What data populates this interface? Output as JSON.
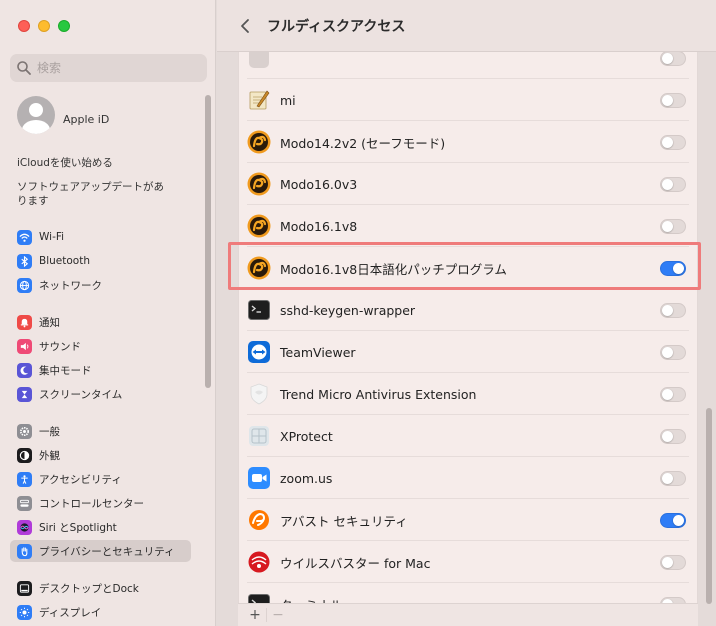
{
  "search": {
    "placeholder": "検索"
  },
  "apple_id": {
    "label": "Apple iD"
  },
  "sidebar_links": [
    {
      "label": "iCloudを使い始める"
    },
    {
      "label": "ソフトウェアアップデートがあります"
    }
  ],
  "sidebar": {
    "items": [
      {
        "label": "Wi-Fi",
        "icon": "wifi-icon",
        "color": "#2f7df6"
      },
      {
        "label": "Bluetooth",
        "icon": "bluetooth-icon",
        "color": "#2f7df6"
      },
      {
        "label": "ネットワーク",
        "icon": "globe-icon",
        "color": "#2f7df6"
      },
      {
        "label": "通知",
        "icon": "bell-icon",
        "color": "#ef4a47"
      },
      {
        "label": "サウンド",
        "icon": "speaker-icon",
        "color": "#ef4a76"
      },
      {
        "label": "集中モード",
        "icon": "moon-icon",
        "color": "#5a55d6"
      },
      {
        "label": "スクリーンタイム",
        "icon": "hourglass-icon",
        "color": "#5a55d6"
      },
      {
        "label": "一般",
        "icon": "gear-icon",
        "color": "#8e8e93"
      },
      {
        "label": "外観",
        "icon": "appearance-icon",
        "color": "#1c1c1e"
      },
      {
        "label": "アクセシビリティ",
        "icon": "accessibility-icon",
        "color": "#2f7df6"
      },
      {
        "label": "コントロールセンター",
        "icon": "control-center-icon",
        "color": "#8e8e93"
      },
      {
        "label": "Siri とSpotlight",
        "icon": "siri-icon",
        "color": "#b03bd9"
      },
      {
        "label": "プライバシーとセキュリティ",
        "icon": "hand-icon",
        "color": "#2f7df6",
        "selected": true
      },
      {
        "label": "デスクトップとDock",
        "icon": "dock-icon",
        "color": "#1c1c1e"
      },
      {
        "label": "ディスプレイ",
        "icon": "sun-icon",
        "color": "#2f7df6"
      }
    ]
  },
  "header": {
    "title": "フルディスクアクセス"
  },
  "apps": [
    {
      "name": "",
      "icon": "unknown-icon",
      "enabled": false
    },
    {
      "name": "mi",
      "icon": "mi-icon",
      "enabled": false
    },
    {
      "name": "Modo14.2v2 (セーフモード)",
      "icon": "modo-icon",
      "enabled": false
    },
    {
      "name": "Modo16.0v3",
      "icon": "modo-icon",
      "enabled": false
    },
    {
      "name": "Modo16.1v8",
      "icon": "modo-icon",
      "enabled": false
    },
    {
      "name": "Modo16.1v8日本語化パッチプログラム",
      "icon": "modo-icon",
      "enabled": true
    },
    {
      "name": "sshd-keygen-wrapper",
      "icon": "terminal-icon",
      "enabled": false
    },
    {
      "name": "TeamViewer",
      "icon": "teamviewer-icon",
      "enabled": false
    },
    {
      "name": "Trend Micro Antivirus Extension",
      "icon": "trendmicro-icon",
      "enabled": false
    },
    {
      "name": "XProtect",
      "icon": "xprotect-icon",
      "enabled": false
    },
    {
      "name": "zoom.us",
      "icon": "zoom-icon",
      "enabled": false
    },
    {
      "name": "アバスト セキュリティ",
      "icon": "avast-icon",
      "enabled": true
    },
    {
      "name": "ウイルスバスター for Mac",
      "icon": "virusbuster-icon",
      "enabled": false
    },
    {
      "name": "ターミナル",
      "icon": "terminal-icon",
      "enabled": false
    }
  ],
  "footer": {
    "add": "+",
    "remove": "−"
  },
  "colors": {
    "accent": "#2f7df6",
    "highlight": "#ef7b7b"
  }
}
